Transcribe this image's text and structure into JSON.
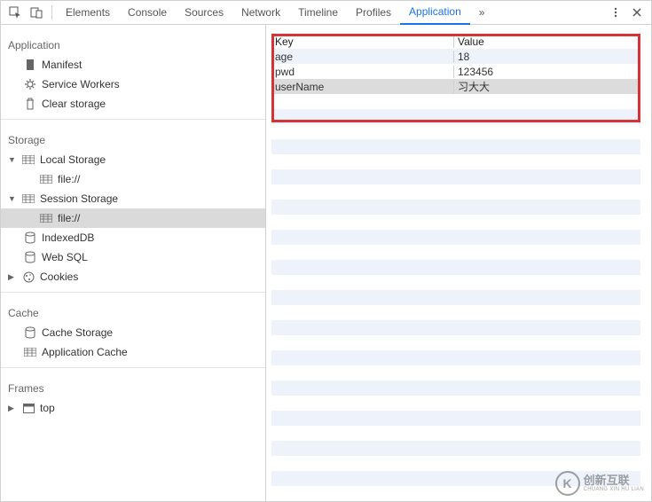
{
  "tabs": {
    "elements": "Elements",
    "console": "Console",
    "sources": "Sources",
    "network": "Network",
    "timeline": "Timeline",
    "profiles": "Profiles",
    "application": "Application",
    "more": "»"
  },
  "sidebar": {
    "application": {
      "title": "Application",
      "manifest": "Manifest",
      "service_workers": "Service Workers",
      "clear_storage": "Clear storage"
    },
    "storage": {
      "title": "Storage",
      "local_storage": "Local Storage",
      "local_file": "file://",
      "session_storage": "Session Storage",
      "session_file": "file://",
      "indexeddb": "IndexedDB",
      "websql": "Web SQL",
      "cookies": "Cookies"
    },
    "cache": {
      "title": "Cache",
      "cache_storage": "Cache Storage",
      "application_cache": "Application Cache"
    },
    "frames": {
      "title": "Frames",
      "top": "top"
    }
  },
  "table": {
    "header_key": "Key",
    "header_value": "Value",
    "rows": [
      {
        "key": "age",
        "value": "18"
      },
      {
        "key": "pwd",
        "value": "123456"
      },
      {
        "key": "userName",
        "value": "习大大"
      }
    ]
  },
  "watermark": {
    "cn": "创新互联",
    "en": "CHUANG XIN HU LIAN"
  }
}
